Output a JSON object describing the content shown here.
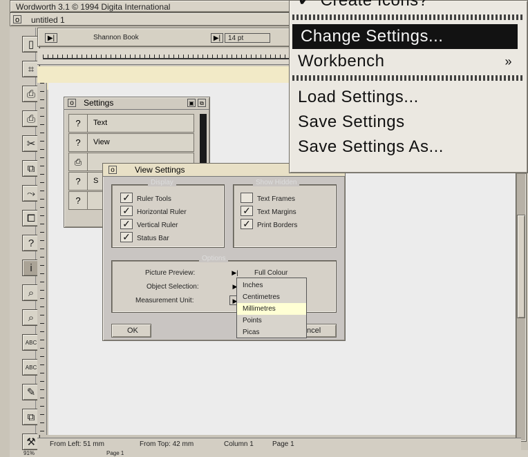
{
  "app": {
    "title": "Wordworth 3.1  © 1994 Digita International",
    "doc_title": "untitled 1",
    "window_icon": "o"
  },
  "toolbar": {
    "style_name": "Shannon Book",
    "size_value": "14 pt"
  },
  "toolbox": [
    {
      "icon": "page-icon",
      "glyph": "▯"
    },
    {
      "icon": "select-icon",
      "glyph": "⌗"
    },
    {
      "icon": "print-icon",
      "glyph": "⎙"
    },
    {
      "icon": "print-menu-icon",
      "glyph": "⎙"
    },
    {
      "icon": "cut-icon",
      "glyph": "✂"
    },
    {
      "icon": "copy-icon",
      "glyph": "⧉"
    },
    {
      "icon": "paste-icon",
      "glyph": "⤳"
    },
    {
      "icon": "clipboard-icon",
      "glyph": "⧠"
    },
    {
      "icon": "help-icon",
      "glyph": "?"
    },
    {
      "icon": "info-icon",
      "glyph": "i"
    },
    {
      "icon": "search-icon",
      "glyph": "⌕"
    },
    {
      "icon": "replace-icon",
      "glyph": "⌕"
    },
    {
      "icon": "spell-check-icon",
      "glyph": "ABC"
    },
    {
      "icon": "thesaurus-icon",
      "glyph": "ABC"
    },
    {
      "icon": "highlight-icon",
      "glyph": "✎"
    },
    {
      "icon": "stack-icon",
      "glyph": "⧉"
    },
    {
      "icon": "tools-icon",
      "glyph": "⚒"
    }
  ],
  "menu": {
    "items": [
      {
        "label": "Create Icons?",
        "checked": true
      },
      {
        "label": "Change Settings...",
        "highlighted": true
      },
      {
        "label": "Workbench",
        "submenu": "»"
      },
      {
        "label": "Load Settings..."
      },
      {
        "label": "Save Settings"
      },
      {
        "label": "Save Settings As..."
      }
    ]
  },
  "settings_window": {
    "title": "Settings",
    "close_label": "o",
    "rows": [
      {
        "label": "Text",
        "icon": "text-settings-icon",
        "glyph": "?"
      },
      {
        "label": "View",
        "icon": "view-settings-icon",
        "glyph": "?"
      },
      {
        "label": "",
        "icon": "print-settings-icon",
        "glyph": "⎙"
      },
      {
        "label": "S",
        "icon": "spell-settings-icon",
        "glyph": "?"
      },
      {
        "label": "",
        "icon": "file-settings-icon",
        "glyph": "?"
      }
    ]
  },
  "view_settings": {
    "title": "View Settings",
    "close_label": "o",
    "group1": {
      "title": "Display",
      "items": [
        {
          "label": "Ruler Tools",
          "checked": true
        },
        {
          "label": "Horizontal Ruler",
          "checked": true
        },
        {
          "label": "Vertical Ruler",
          "checked": true
        },
        {
          "label": "Status Bar",
          "checked": true
        }
      ]
    },
    "group2": {
      "title": "Show Hidden",
      "items": [
        {
          "label": "Text Frames",
          "checked": false
        },
        {
          "label": "Text Margins",
          "checked": true
        },
        {
          "label": "Print Borders",
          "checked": true
        }
      ]
    },
    "group3": {
      "title": "Options",
      "picture_preview_label": "Picture Preview:",
      "picture_preview_value": "Full Colour",
      "object_selection_label": "Object Selection:",
      "measurement_unit_label": "Measurement Unit:",
      "measurement_options": [
        "Inches",
        "Centimetres",
        "Millimetres",
        "Points",
        "Picas"
      ],
      "measurement_selected": "Millimetres"
    },
    "ok_label": "OK",
    "cancel_label": "ncel"
  },
  "status": {
    "from_left": "From Left: 51 mm",
    "from_top": "From Top: 42 mm",
    "column": "Column 1",
    "page": "Page 1",
    "zoom": "91%",
    "page_label": "Page 1"
  }
}
